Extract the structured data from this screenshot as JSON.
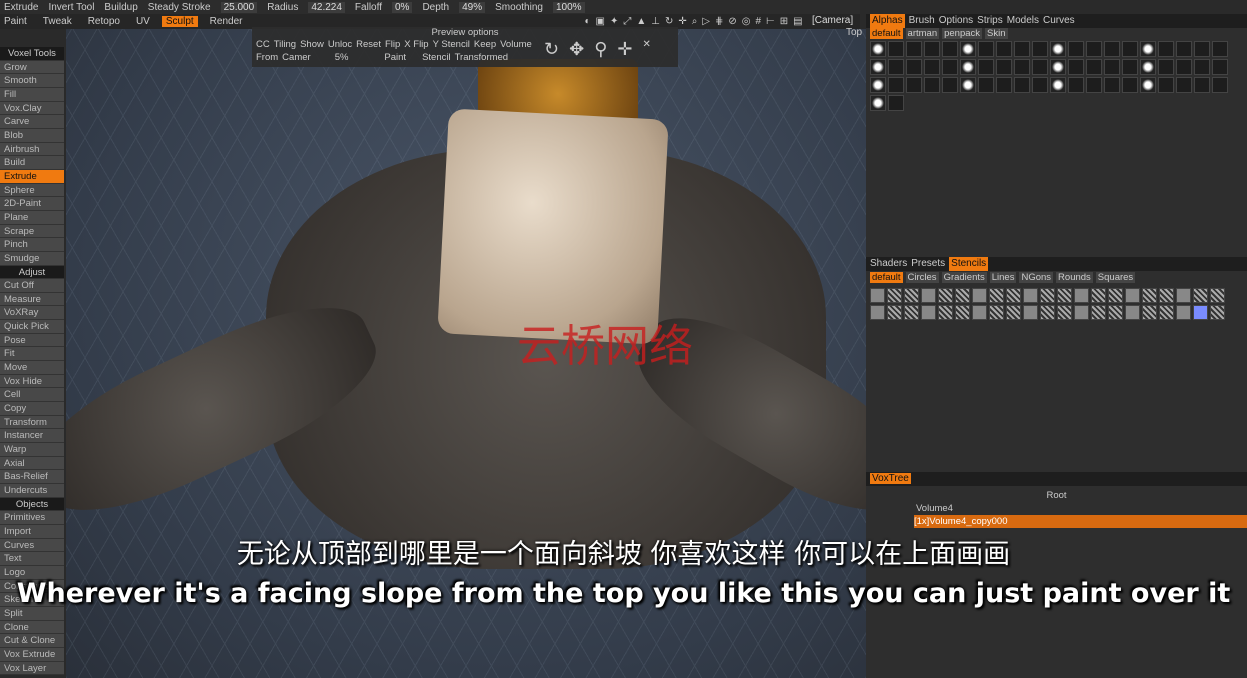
{
  "toolbar": {
    "tool": "Extrude",
    "invert": "Invert Tool",
    "buildup": "Buildup",
    "steady": "Steady Stroke",
    "steady_val": "25.000",
    "radius": "Radius",
    "radius_val": "42.224",
    "falloff": "Falloff",
    "falloff_val": "0%",
    "depth": "Depth",
    "depth_val": "49%",
    "smoothing": "Smoothing",
    "smoothing_val": "100%"
  },
  "rooms": [
    {
      "label": "Paint"
    },
    {
      "label": "Tweak"
    },
    {
      "label": "Retopo"
    },
    {
      "label": "UV"
    },
    {
      "label": "Sculpt",
      "active": true
    },
    {
      "label": "Render"
    }
  ],
  "viewport": {
    "camera": "[Camera]",
    "view": "Top"
  },
  "preview": {
    "title": "Preview options",
    "row1": [
      "CC",
      "Tiling",
      "Show",
      "Unloc",
      "Reset",
      "Flip",
      "X Flip",
      "Y Stencil",
      "Keep",
      "Volume"
    ],
    "row2": [
      "From",
      "Camer",
      "5%",
      "Paint",
      "Stencil",
      "Transformed"
    ]
  },
  "left": [
    {
      "label": "Voxel Tools",
      "sec": true
    },
    {
      "label": "Grow"
    },
    {
      "label": "Smooth"
    },
    {
      "label": "Fill"
    },
    {
      "label": "Vox.Clay"
    },
    {
      "label": "Carve"
    },
    {
      "label": "Blob"
    },
    {
      "label": "Airbrush"
    },
    {
      "label": "Build"
    },
    {
      "label": "Extrude",
      "active": true
    },
    {
      "label": "Sphere"
    },
    {
      "label": "2D-Paint"
    },
    {
      "label": "Plane"
    },
    {
      "label": "Scrape"
    },
    {
      "label": "Pinch"
    },
    {
      "label": "Smudge"
    },
    {
      "label": "Adjust",
      "sec": true
    },
    {
      "label": "Cut Off"
    },
    {
      "label": "Measure"
    },
    {
      "label": "VoXRay"
    },
    {
      "label": "Quick Pick"
    },
    {
      "label": "Pose"
    },
    {
      "label": "Fit"
    },
    {
      "label": "Move"
    },
    {
      "label": "Vox Hide"
    },
    {
      "label": "Cell"
    },
    {
      "label": "Copy"
    },
    {
      "label": "Transform"
    },
    {
      "label": "Instancer"
    },
    {
      "label": "Warp"
    },
    {
      "label": "Axial"
    },
    {
      "label": "Bas-Relief"
    },
    {
      "label": "Undercuts"
    },
    {
      "label": "Objects",
      "sec": true
    },
    {
      "label": "Primitives"
    },
    {
      "label": "Import"
    },
    {
      "label": "Curves"
    },
    {
      "label": "Text"
    },
    {
      "label": "Logo"
    },
    {
      "label": "Constructor"
    },
    {
      "label": "Sketch"
    },
    {
      "label": "Split"
    },
    {
      "label": "Clone"
    },
    {
      "label": "Cut & Clone"
    },
    {
      "label": "Vox Extrude"
    },
    {
      "label": "Vox Layer"
    }
  ],
  "right": {
    "tabs": [
      "Alphas",
      "Brush",
      "Options",
      "Strips",
      "Models",
      "Curves"
    ],
    "alpha_sets": [
      "default",
      "artman",
      "penpack",
      "Skin"
    ],
    "shader_tabs": [
      "Shaders",
      "Presets",
      "Stencils"
    ],
    "stencil_sets": [
      "default",
      "Circles",
      "Gradients",
      "Lines",
      "NGons",
      "Rounds",
      "Squares"
    ],
    "voxtree": "VoxTree",
    "tree": [
      "Root",
      "Volume4",
      "[1x]Volume4_copy000"
    ]
  },
  "watermark": "云桥网络",
  "subtitle_zh": "无论从顶部到哪里是一个面向斜坡 你喜欢这样 你可以在上面画画",
  "subtitle_en": "Wherever it's a facing slope from the top you like this you can just paint over it",
  "colors": {
    "accent": "#f07a10"
  }
}
